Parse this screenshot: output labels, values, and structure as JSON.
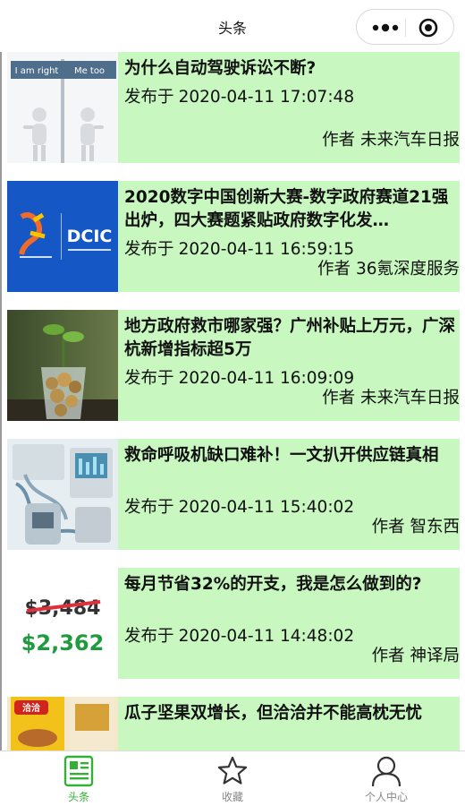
{
  "navbar": {
    "title": "头条"
  },
  "articles": [
    {
      "title": "为什么自动驾驶诉讼不断?",
      "date_prefix": "发布于",
      "date": "2020-04-11 17:07:48",
      "author_prefix": "作者",
      "author": "未来汽车日报",
      "thumb_text_left": "I am right",
      "thumb_text_right": "Me too"
    },
    {
      "title": "2020数字中国创新大赛-数字政府赛道21强出炉，四大赛题紧贴政府数字化发…",
      "date_prefix": "发布于",
      "date": "2020-04-11 16:59:15",
      "author_prefix": "作者",
      "author": "36氪深度服务",
      "thumb_text": "DCIC"
    },
    {
      "title": "地方政府救市哪家强？广州补贴上万元，广深杭新增指标超5万",
      "date_prefix": "发布于",
      "date": "2020-04-11 16:09:09",
      "author_prefix": "作者",
      "author": "未来汽车日报"
    },
    {
      "title": "救命呼吸机缺口难补！一文扒开供应链真相",
      "date_prefix": "发布于",
      "date": "2020-04-11 15:40:02",
      "author_prefix": "作者",
      "author": "智东西"
    },
    {
      "title": "每月节省32%的开支，我是怎么做到的?",
      "date_prefix": "发布于",
      "date": "2020-04-11 14:48:02",
      "author_prefix": "作者",
      "author": "神译局",
      "thumb_old_price": "$3,484",
      "thumb_new_price": "$2,362"
    },
    {
      "title": "瓜子坚果双增长，但洽洽并不能高枕无忧",
      "thumb_brand": "洽洽"
    }
  ],
  "tabbar": {
    "items": [
      {
        "label": "头条",
        "icon": "news-icon",
        "active": true
      },
      {
        "label": "收藏",
        "icon": "star-icon",
        "active": false
      },
      {
        "label": "个人中心",
        "icon": "person-icon",
        "active": false
      }
    ]
  },
  "colors": {
    "card_background": "#c8f7c0",
    "active_tab": "#35b036",
    "inactive_tab": "#888888"
  }
}
